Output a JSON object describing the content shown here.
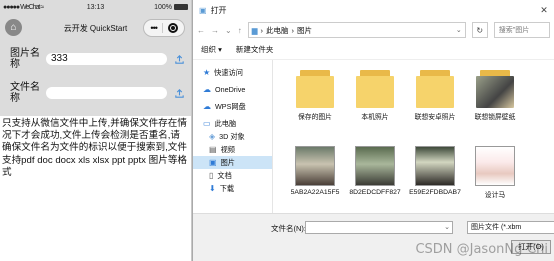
{
  "phone": {
    "status": {
      "carrier": "WeChat",
      "time": "13:13",
      "battery": "100%"
    },
    "nav_title": "云开发 QuickStart",
    "fields": [
      {
        "label": "图片名称",
        "value": "333"
      },
      {
        "label": "文件名称",
        "value": ""
      }
    ],
    "notice": "只支持从微信文件中上传,并确保文件存在情况下才会成功,文件上传会检测是否重名,请确保文件名为文件的标识以便于搜索到,文件支持pdf doc docx xls xlsx ppt pptx 图片等格式"
  },
  "dialog": {
    "title": "打开",
    "path": [
      "此电脑",
      "图片"
    ],
    "search_placeholder": "搜索\"图片",
    "toolbar": {
      "organize": "组织",
      "new_folder": "新建文件夹"
    },
    "nav_items": [
      {
        "label": "快速访问",
        "icon": "star-icon"
      },
      {
        "label": "OneDrive",
        "icon": "cloud-icon"
      },
      {
        "label": "WPS网盘",
        "icon": "cloud-icon"
      },
      {
        "label": "此电脑",
        "icon": "computer-icon"
      },
      {
        "label": "3D 对象",
        "icon": "cube-icon"
      },
      {
        "label": "视频",
        "icon": "video-icon"
      },
      {
        "label": "图片",
        "icon": "picture-icon"
      },
      {
        "label": "文档",
        "icon": "document-icon"
      },
      {
        "label": "下载",
        "icon": "download-icon"
      }
    ],
    "files": [
      {
        "name": "保存的图片",
        "kind": "folder"
      },
      {
        "name": "本机照片",
        "kind": "folder"
      },
      {
        "name": "联想安卓照片",
        "kind": "folder"
      },
      {
        "name": "联想锁屏壁纸",
        "kind": "folder-photo"
      },
      {
        "name": "5AB2A22A15F5",
        "kind": "image"
      },
      {
        "name": "8D2EDCDFF827",
        "kind": "image"
      },
      {
        "name": "E59E2FDBDAB7",
        "kind": "image"
      },
      {
        "name": "设计马",
        "kind": "image"
      }
    ],
    "filename_label": "文件名(N):",
    "filename_value": "",
    "filetype": "图片文件 (*.xbm",
    "open_label": "打开(O)"
  },
  "watermark": "CSDN @JasonNg-Chi",
  "colors": {
    "folder": "#f6d36b",
    "selection": "#cce4f7",
    "panel": "#dcdcdc"
  }
}
